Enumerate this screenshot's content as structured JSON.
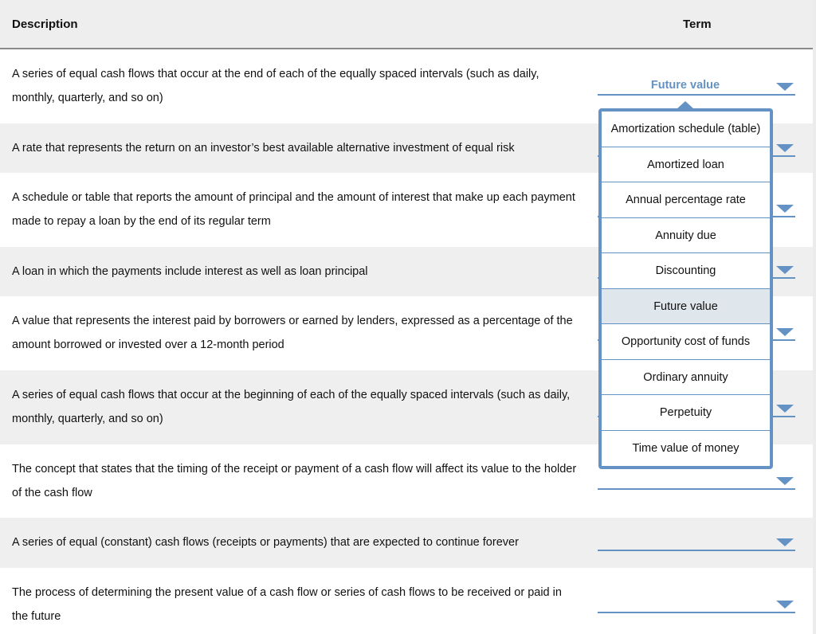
{
  "header": {
    "description": "Description",
    "term": "Term"
  },
  "rows": [
    {
      "description": "A series of equal cash flows that occur at the end of each of the equally spaced intervals (such as daily, monthly, quarterly, and so on)",
      "selected": "Future value"
    },
    {
      "description": "A rate that represents the return on an investor’s best available alternative investment of equal risk",
      "selected": ""
    },
    {
      "description": "A schedule or table that reports the amount of principal and the amount of interest that make up each payment made to repay a loan by the end of its regular term",
      "selected": ""
    },
    {
      "description": "A loan in which the payments include interest as well as loan principal",
      "selected": ""
    },
    {
      "description": "A value that represents the interest paid by borrowers or earned by lenders, expressed as a percentage of the amount borrowed or invested over a 12-month period",
      "selected": ""
    },
    {
      "description": "A series of equal cash flows that occur at the beginning of each of the equally spaced intervals (such as daily, monthly, quarterly, and so on)",
      "selected": ""
    },
    {
      "description": "The concept that states that the timing of the receipt or payment of a cash flow will affect its value to the holder of the cash flow",
      "selected": ""
    },
    {
      "description": "A series of equal (constant) cash flows (receipts or payments) that are expected to continue forever",
      "selected": ""
    },
    {
      "description": "The process of determining the present value of a cash flow or series of cash flows to be received or paid in the future",
      "selected": ""
    }
  ],
  "dropdown_menu": {
    "highlighted": "Future value",
    "options": [
      "Amortization schedule (table)",
      "Amortized loan",
      "Annual percentage rate",
      "Annuity due",
      "Discounting",
      "Future value",
      "Opportunity cost of funds",
      "Ordinary annuity",
      "Perpetuity",
      "Time value of money"
    ]
  },
  "colors": {
    "accent": "#6492c4",
    "row_alt": "#efefef",
    "header_bg": "#eeeeee",
    "highlight": "#dfe6ec"
  }
}
